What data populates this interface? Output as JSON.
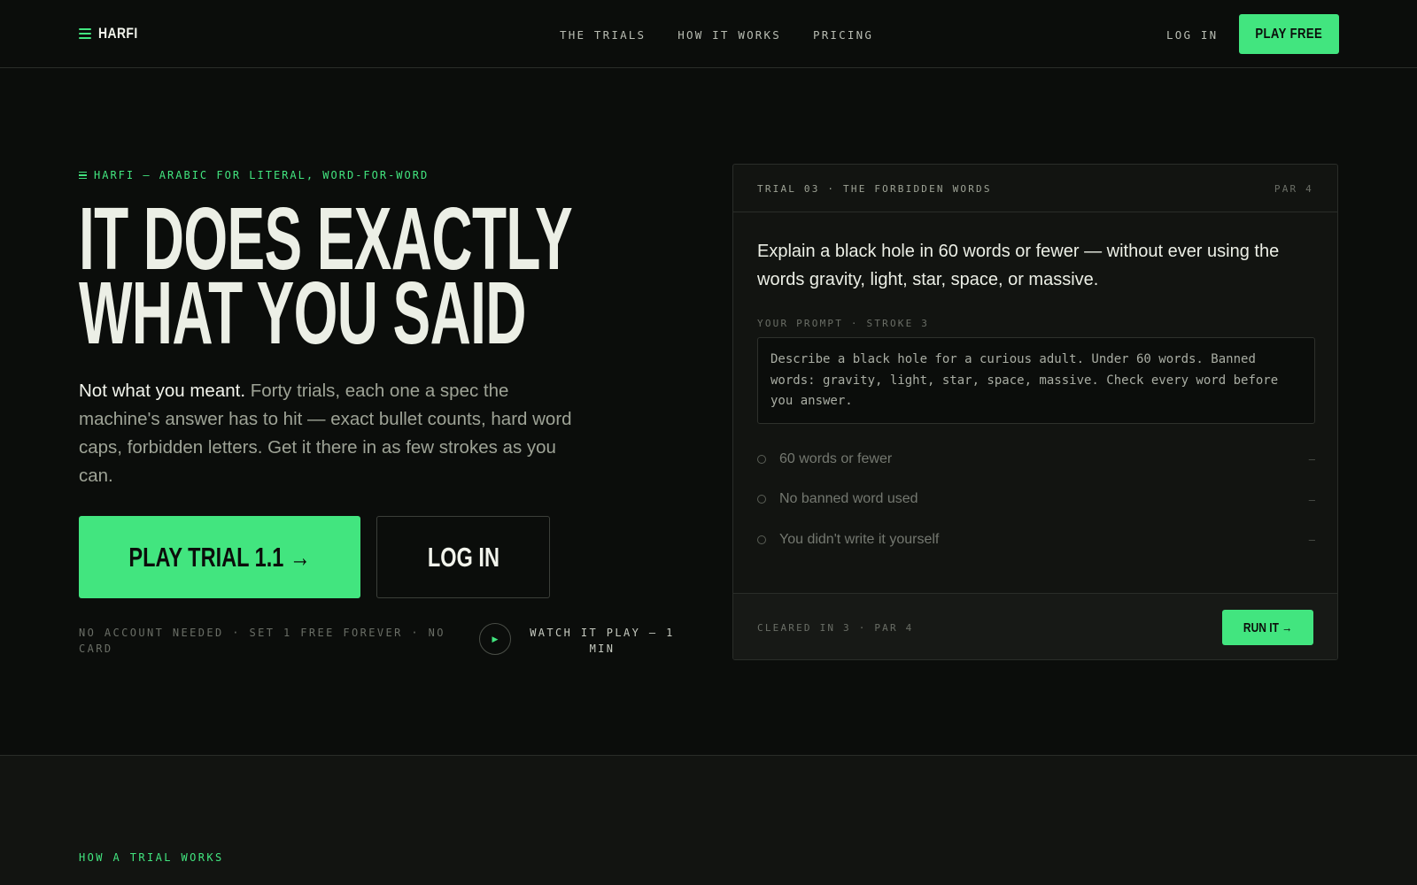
{
  "nav": {
    "brand": "HARFI",
    "links": [
      "THE TRIALS",
      "HOW IT WORKS",
      "PRICING"
    ],
    "login": "LOG IN",
    "cta": "PLAY FREE"
  },
  "hero": {
    "eyebrow": "HARFI — ARABIC FOR LITERAL, WORD-FOR-WORD",
    "headline_line1": "IT DOES EXACTLY",
    "headline_line2": "WHAT YOU SAID",
    "lede_strong": "Not what you meant.",
    "lede_rest": " Forty trials, each one a spec the machine's answer has to hit — exact bullet counts, hard word caps, forbidden letters. Get it there in as few strokes as you can.",
    "primary_button": "PLAY TRIAL 1.1 →",
    "secondary_button": "LOG IN",
    "fineprint": "NO ACCOUNT NEEDED · SET 1 FREE FOREVER · NO CARD",
    "play_glyph": "▶",
    "watch": "WATCH IT PLAY — 1 MIN"
  },
  "trial_card": {
    "title": "TRIAL 03 · THE FORBIDDEN WORDS",
    "par": "PAR 4",
    "task": "Explain a black hole in 60 words or fewer — without ever using the words gravity, light, star, space, or massive.",
    "prompt_label": "YOUR PROMPT · STROKE 3",
    "prompt_text": "Describe a black hole for a curious adult. Under 60 words. Banned words: gravity, light, star, space, massive. Check every word before you answer.",
    "checks": [
      {
        "label": "60 words or fewer",
        "status": "–"
      },
      {
        "label": "No banned word used",
        "status": "–"
      },
      {
        "label": "You didn't write it yourself",
        "status": "–"
      }
    ],
    "footer_meta": "CLEARED IN 3 · PAR 4",
    "run_button": "RUN IT →"
  },
  "section2": {
    "label": "HOW A TRIAL WORKS"
  },
  "colors": {
    "accent": "#42e57f",
    "background": "#0b0d0b",
    "card": "#121411"
  }
}
